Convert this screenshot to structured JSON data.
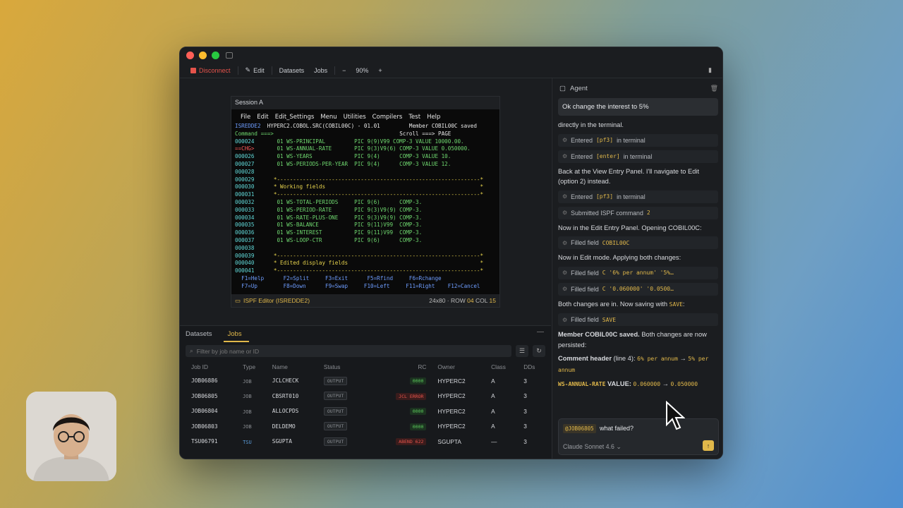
{
  "toolbar": {
    "disconnect": "Disconnect",
    "edit": "Edit",
    "datasets": "Datasets",
    "jobs": "Jobs",
    "zoom_minus": "−",
    "zoom": "90%",
    "zoom_plus": "+"
  },
  "session": {
    "title": "Session A",
    "menu": [
      "File",
      "Edit",
      "Edit_Settings",
      "Menu",
      "Utilities",
      "Compilers",
      "Test",
      "Help"
    ],
    "status_left": "ISPF Editor (ISREDDE2)",
    "status_dims": "24x80 · ROW",
    "status_row": "04",
    "status_col_label": "COL",
    "status_col": "15"
  },
  "terminal": {
    "line1_a": "ISREDDE2",
    "line1_b": "HYPERC2.COBOL.SRC(COBIL00C) - 01.01",
    "line1_c": "Member COBIL00C saved",
    "line2_a": "Command ===>",
    "line2_b": "Scroll ===> PAGE",
    "rows": [
      {
        "num": "000024",
        "text": "       01 WS-PRINCIPAL         PIC 9(9)V99 COMP-3 VALUE 10000.00."
      },
      {
        "num": "==CHG>",
        "text": "       01 WS-ANNUAL-RATE       PIC 9(3)V9(6) COMP-3 VALUE 0.050000."
      },
      {
        "num": "000026",
        "text": "       01 WS-YEARS             PIC 9(4)      COMP-3 VALUE 10."
      },
      {
        "num": "000027",
        "text": "       01 WS-PERIODS-PER-YEAR  PIC 9(4)      COMP-3 VALUE 12."
      },
      {
        "num": "000028",
        "text": ""
      },
      {
        "num": "000029",
        "text": "      *---------------------------------------------------------------*"
      },
      {
        "num": "000030",
        "text": "      * Working fields                                                *"
      },
      {
        "num": "000031",
        "text": "      *---------------------------------------------------------------*"
      },
      {
        "num": "000032",
        "text": "       01 WS-TOTAL-PERIODS     PIC 9(6)      COMP-3."
      },
      {
        "num": "000033",
        "text": "       01 WS-PERIOD-RATE       PIC 9(3)V9(9) COMP-3."
      },
      {
        "num": "000034",
        "text": "       01 WS-RATE-PLUS-ONE     PIC 9(3)V9(9) COMP-3."
      },
      {
        "num": "000035",
        "text": "       01 WS-BALANCE           PIC 9(11)V99  COMP-3."
      },
      {
        "num": "000036",
        "text": "       01 WS-INTEREST          PIC 9(11)V99  COMP-3."
      },
      {
        "num": "000037",
        "text": "       01 WS-LOOP-CTR          PIC 9(6)      COMP-3."
      },
      {
        "num": "000038",
        "text": ""
      },
      {
        "num": "000039",
        "text": "      *---------------------------------------------------------------*"
      },
      {
        "num": "000040",
        "text": "      * Edited display fields                                         *"
      },
      {
        "num": "000041",
        "text": "      *---------------------------------------------------------------*"
      }
    ],
    "fkeys1": "  F1=Help      F2=Split     F3=Exit      F5=Rfind     F6=Rchange",
    "fkeys2": "  F7=Up        F8=Down      F9=Swap     F10=Left     F11=Right    F12=Cancel"
  },
  "bottom": {
    "tabs": [
      "Datasets",
      "Jobs"
    ],
    "minimize": "—",
    "filter_placeholder": "Filter by job name or ID",
    "columns": [
      "Job ID",
      "Type",
      "Name",
      "Status",
      "RC",
      "Owner",
      "Class",
      "DDs"
    ],
    "rows": [
      {
        "id": "JOB06886",
        "type": "JOB",
        "name": "JCLCHECK",
        "status": "OUTPUT",
        "rc": "0000",
        "owner": "HYPERC2",
        "class": "A",
        "dds": "3"
      },
      {
        "id": "JOB06805",
        "type": "JOB",
        "name": "CBSRT010",
        "status": "OUTPUT",
        "rc": "JCL ERROR",
        "owner": "HYPERC2",
        "class": "A",
        "dds": "3"
      },
      {
        "id": "JOB06804",
        "type": "JOB",
        "name": "ALLOCPDS",
        "status": "OUTPUT",
        "rc": "0000",
        "owner": "HYPERC2",
        "class": "A",
        "dds": "3"
      },
      {
        "id": "JOB06803",
        "type": "JOB",
        "name": "DELDEMO",
        "status": "OUTPUT",
        "rc": "0000",
        "owner": "HYPERC2",
        "class": "A",
        "dds": "3"
      },
      {
        "id": "TSU06791",
        "type": "TSU",
        "name": "SGUPTA",
        "status": "OUTPUT",
        "rc": "ABEND 622",
        "owner": "SGUPTA",
        "class": "—",
        "dds": "3"
      }
    ]
  },
  "agent": {
    "title": "Agent",
    "user_msg": "Ok change the interest to 5%",
    "m1": "directly in the terminal.",
    "t1_a": "Entered",
    "t1_code": "[pf3]",
    "t1_b": "in terminal",
    "t2_a": "Entered",
    "t2_code": "[enter]",
    "t2_b": "in terminal",
    "m2": "Back at the View Entry Panel. I'll navigate to Edit (option 2) instead.",
    "t3_a": "Entered",
    "t3_code": "[pf3]",
    "t3_b": "in terminal",
    "t4_a": "Submitted ISPF command",
    "t4_code": "2",
    "m3": "Now in the Edit Entry Panel. Opening COBIL00C:",
    "t5_a": "Filled field",
    "t5_code": "COBIL00C",
    "m4": "Now in Edit mode. Applying both changes:",
    "t6_a": "Filled field",
    "t6_code": "C '6% per annum' '5%…",
    "t7_a": "Filled field",
    "t7_code": "C '0.060000' '0.0500…",
    "m5_a": "Both changes are in. Now saving with",
    "m5_code": "SAVE",
    "m5_b": ":",
    "t8_a": "Filled field",
    "t8_code": "SAVE",
    "m6_bold": "Member COBIL00C saved.",
    "m6_rest": " Both changes are now persisted:",
    "c1_bold": "Comment header",
    "c1_rest": " (line 4): ",
    "c1_from": "6% per annum",
    "c1_arrow": " → ",
    "c1_to": "5% per annum",
    "c2_bold": "WS-ANNUAL-RATE",
    "c2_mid": " VALUE: ",
    "c2_from": "0.060000",
    "c2_arrow": " → ",
    "c2_to": "0.050000",
    "chip": "@JOB06805",
    "input_text": "what failed?",
    "model": "Claude Sonnet 4.6 ⌄",
    "send": "↑"
  }
}
